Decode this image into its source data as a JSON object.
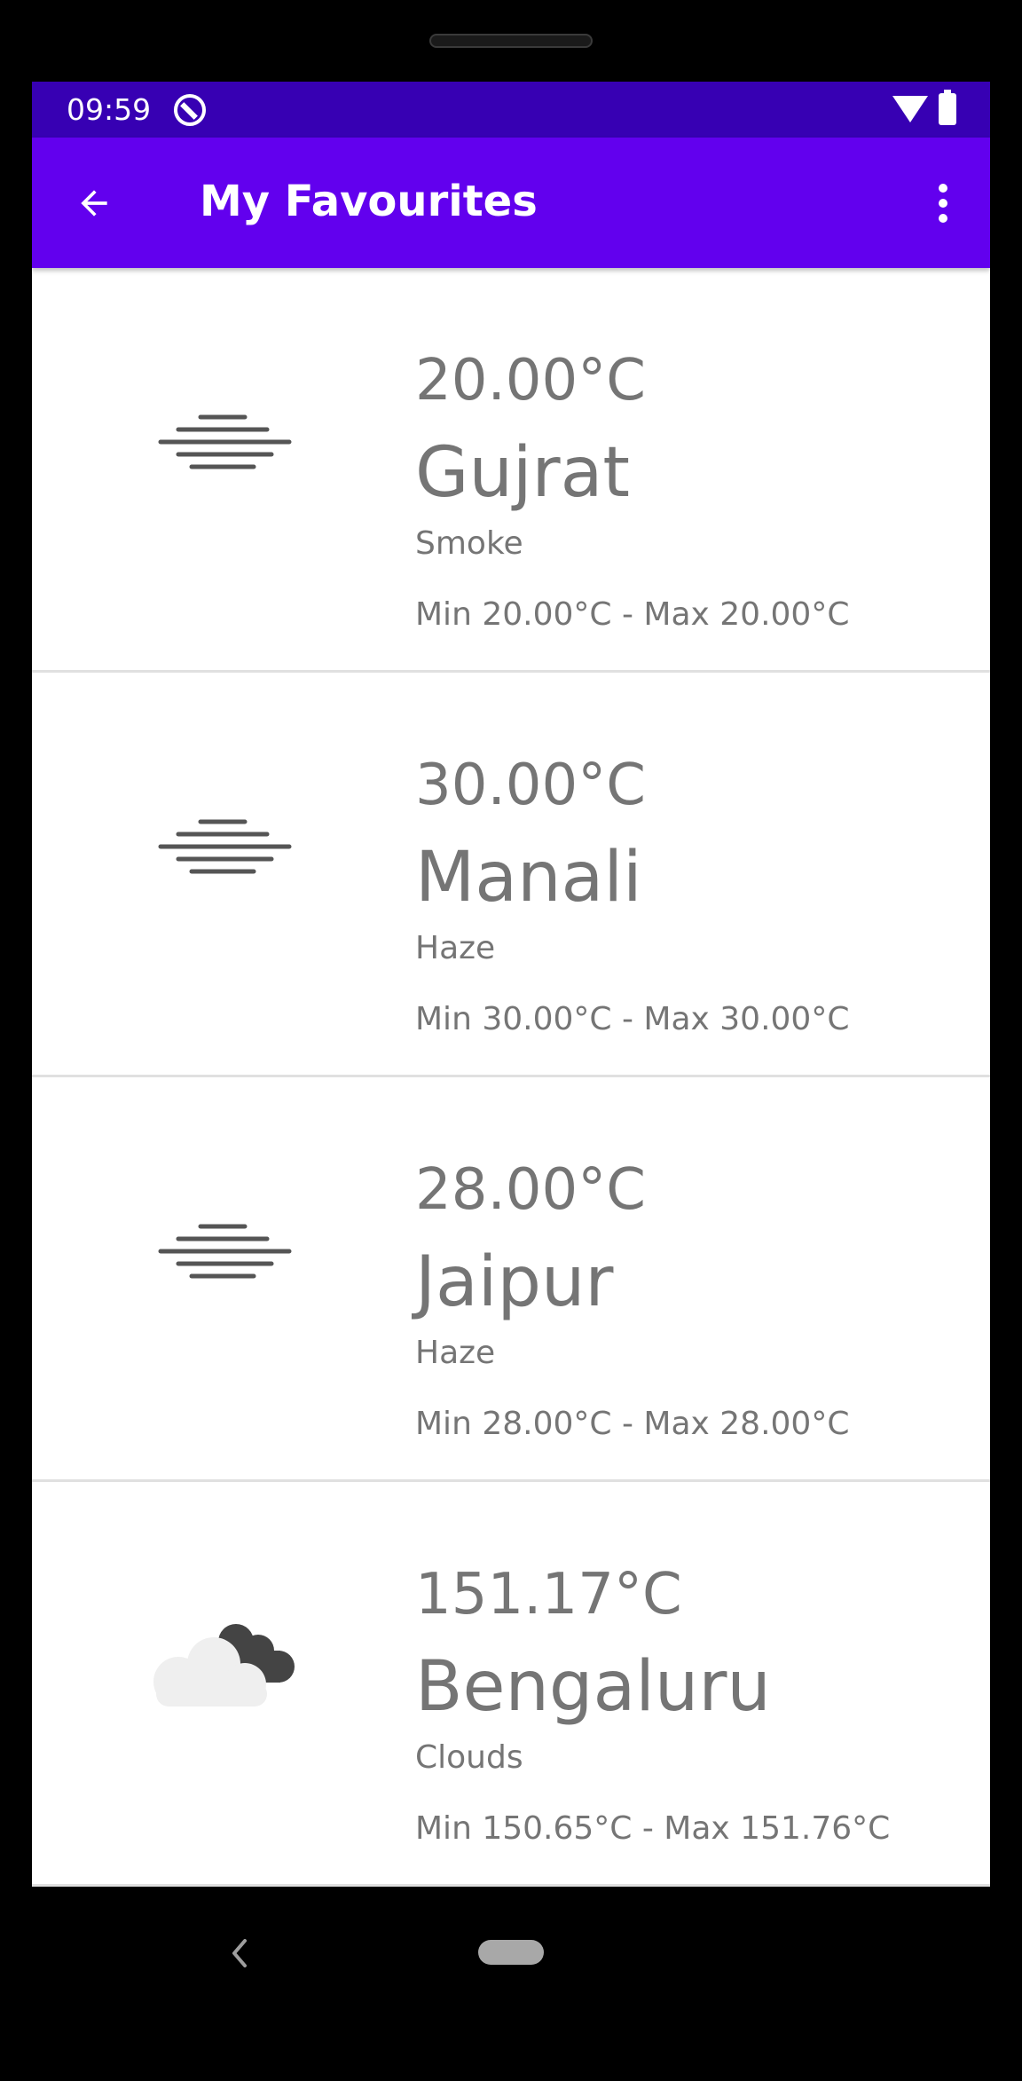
{
  "status_bar": {
    "time": "09:59"
  },
  "app_bar": {
    "title": "My Favourites"
  },
  "favourites": [
    {
      "temp": "20.00°C",
      "city": "Gujrat",
      "description": "Smoke",
      "minmax": "Min 20.00°C - Max 20.00°C",
      "icon": "haze-icon"
    },
    {
      "temp": "30.00°C",
      "city": "Manali",
      "description": "Haze",
      "minmax": "Min 30.00°C - Max 30.00°C",
      "icon": "haze-icon"
    },
    {
      "temp": "28.00°C",
      "city": "Jaipur",
      "description": "Haze",
      "minmax": "Min 28.00°C - Max 28.00°C",
      "icon": "haze-icon"
    },
    {
      "temp": "151.17°C",
      "city": "Bengaluru",
      "description": "Clouds",
      "minmax": "Min 150.65°C - Max 151.76°C",
      "icon": "clouds-icon"
    }
  ],
  "colors": {
    "status_bar": "#3700b3",
    "app_bar": "#6200ee",
    "text": "#757575"
  }
}
